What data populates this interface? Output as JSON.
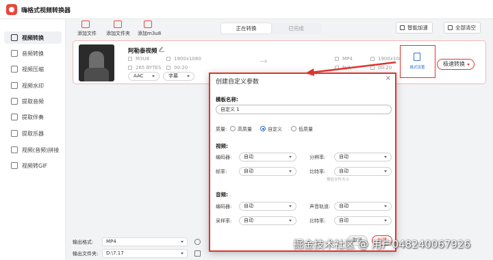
{
  "app": {
    "title": "嗨格式视频转换器",
    "accent": "#e8463c"
  },
  "sidebar": {
    "items": [
      {
        "label": "视频转换",
        "active": true
      },
      {
        "label": "音频转换"
      },
      {
        "label": "视频压缩"
      },
      {
        "label": "视频水印"
      },
      {
        "label": "提取音频"
      },
      {
        "label": "提取伴奏"
      },
      {
        "label": "提取乐器"
      },
      {
        "label": "视频(音频)拼接"
      },
      {
        "label": "视频转GIF"
      }
    ]
  },
  "toolbar": {
    "add_file": "添加文件",
    "add_folder": "添加文件夹",
    "add_m3u8": "添加m3u8"
  },
  "tabs": {
    "converting": "正在转换",
    "done": "已完成"
  },
  "header": {
    "smart_accel": "智能加速",
    "clear_all": "全部清空"
  },
  "file": {
    "name": "阿勒泰视频",
    "src_format": "M3U8",
    "src_resolution": "1900x1080",
    "src_size": "265 BYTES",
    "src_duration": "00:20",
    "dst_format": "MP4",
    "dst_resolution": "1900x1080",
    "dst_size": "N/A",
    "dst_duration": "00:20",
    "audio_select": "AAC",
    "subtitle_select": "字幕",
    "format_settings": "格式设置",
    "speed_convert": "极速转换"
  },
  "bottom": {
    "output_format_label": "输出格式:",
    "output_format_value": "MP4",
    "output_folder_label": "输出文件夹:",
    "output_folder_value": "D:\\7.17"
  },
  "dialog": {
    "title": "创建自定义参数",
    "template_name_label": "模板名称:",
    "template_name_value": "自定义 1",
    "quality_label": "质量:",
    "quality_high": "高质量",
    "quality_custom": "自定义",
    "quality_low": "低质量",
    "video_section": "视频:",
    "encoder_label": "编码器:",
    "resolution_label": "分辨率:",
    "framerate_label": "帧率:",
    "bitrate_label": "比特率:",
    "auto": "自动",
    "predict_size": "预估文件大小",
    "audio_section": "音频:",
    "channel_label": "声音轨道:",
    "samplerate_label": "采样率:",
    "cancel_label": "取消",
    "create_label": "创建"
  },
  "watermark": "掘金技术社区 @ 用户048240067926"
}
